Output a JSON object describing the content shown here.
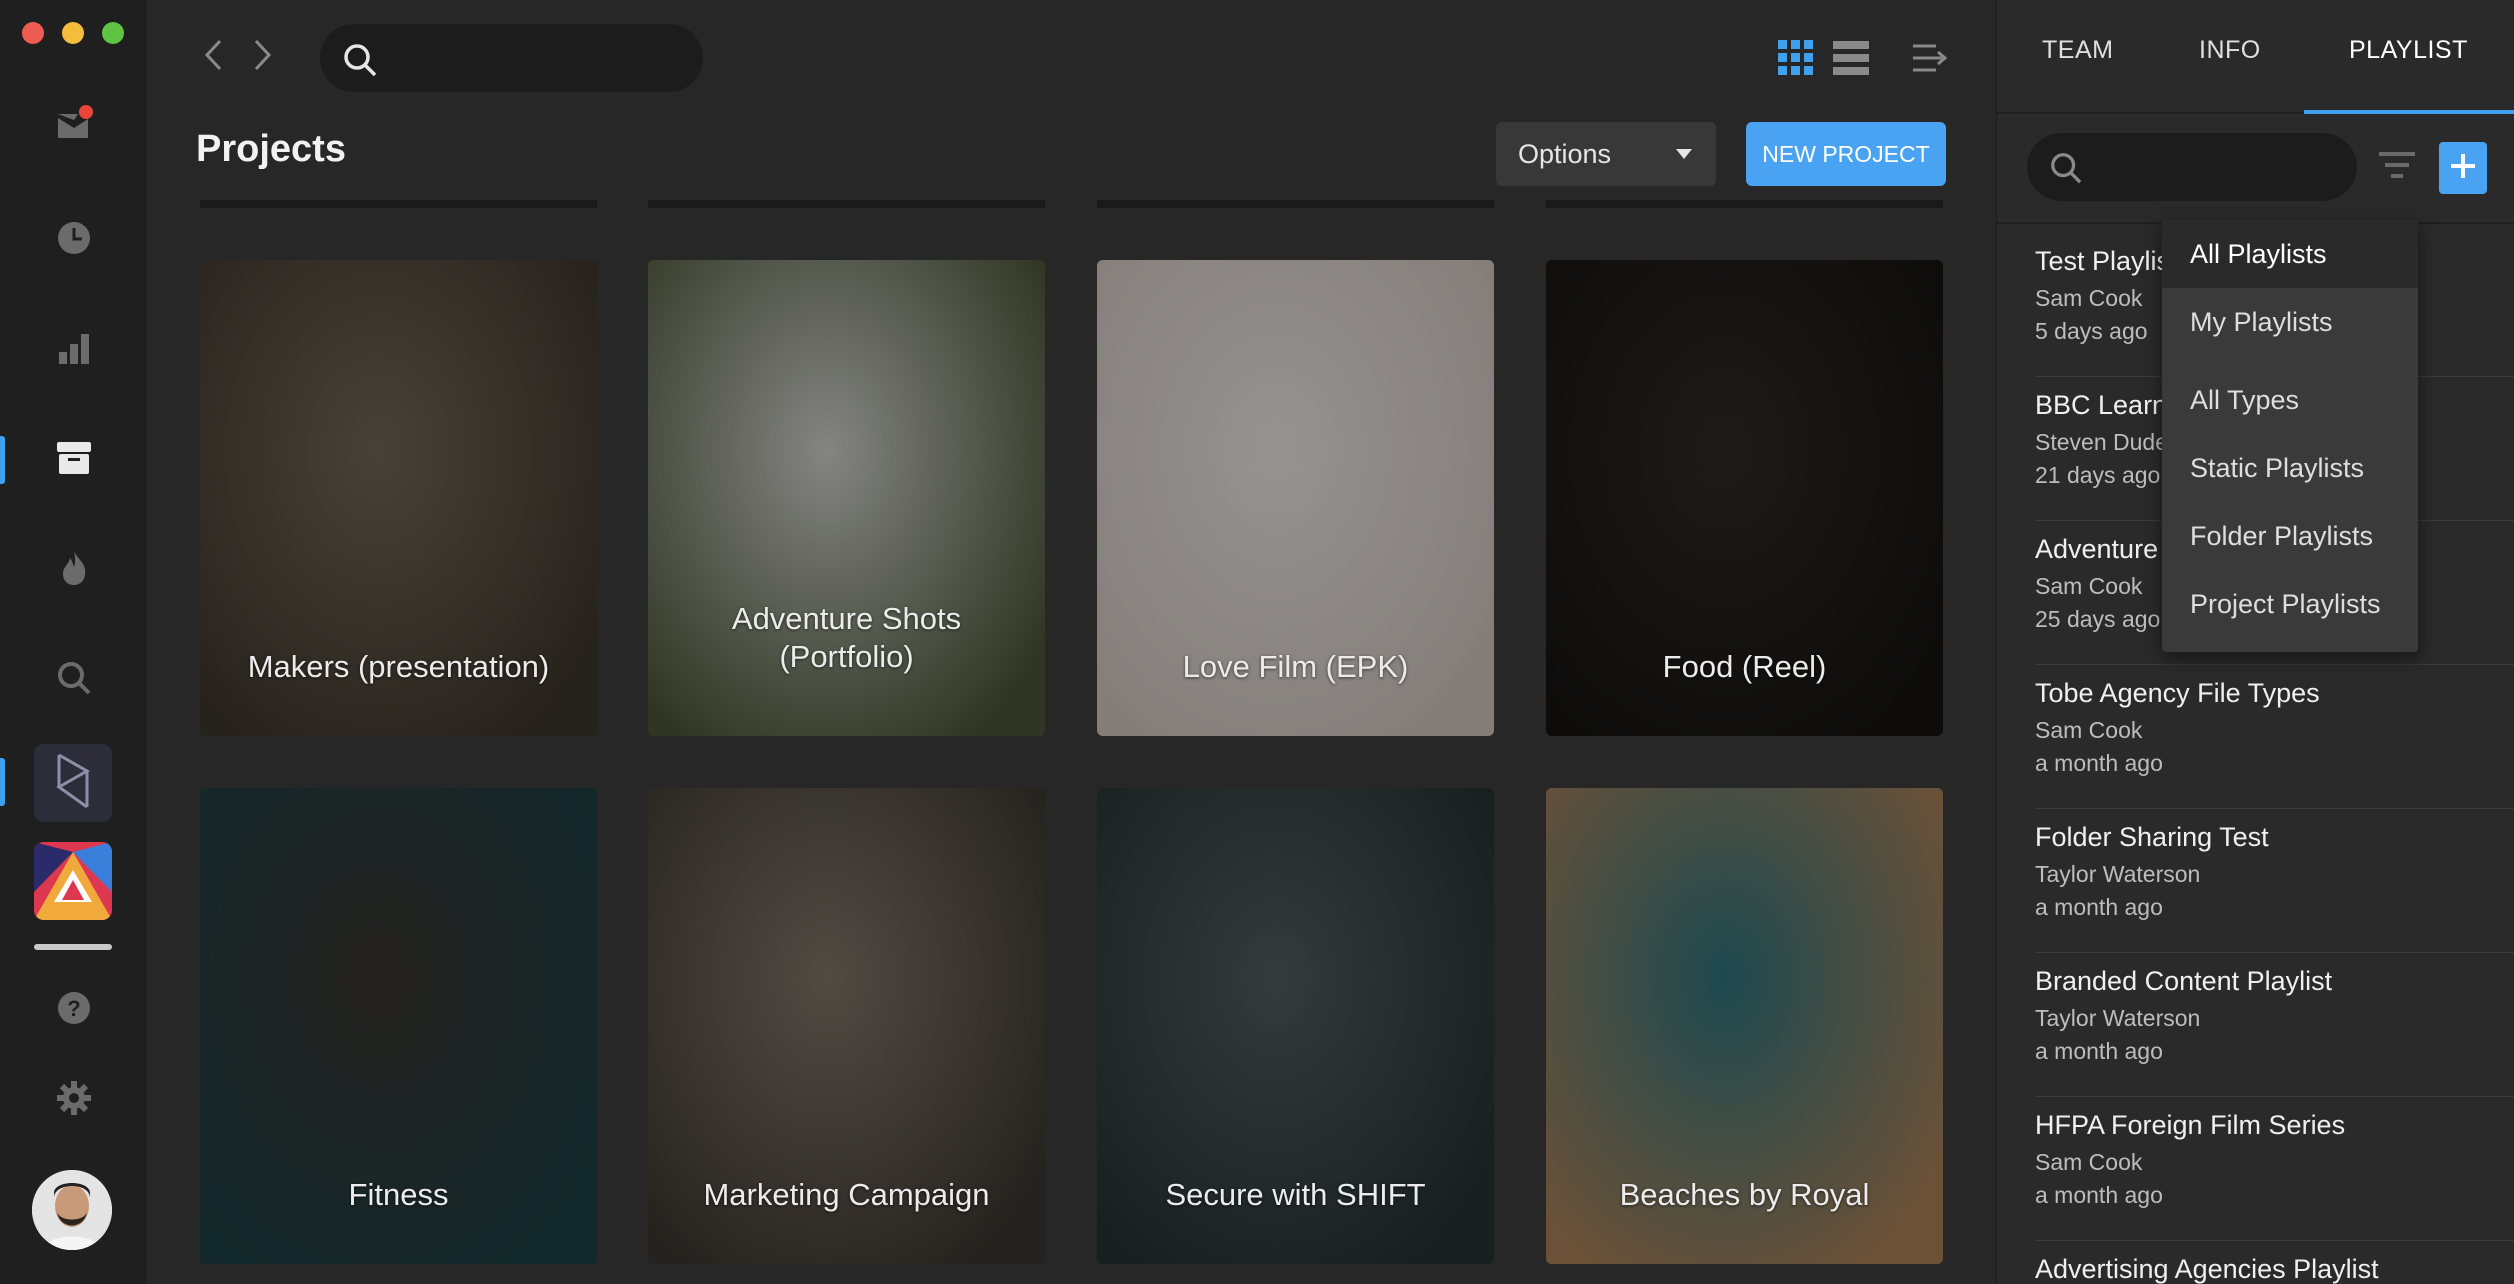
{
  "window": {
    "controls": [
      "close",
      "minimize",
      "maximize"
    ],
    "colors": {
      "close": "#ee5b52",
      "minimize": "#f4bd3b",
      "maximize": "#5fc343"
    }
  },
  "sidebar": {
    "items": [
      {
        "name": "inbox",
        "icon": "inbox-icon",
        "has_badge": true,
        "active": false
      },
      {
        "name": "recent",
        "icon": "clock-icon",
        "active": false
      },
      {
        "name": "analytics",
        "icon": "bar-chart-icon",
        "active": false
      },
      {
        "name": "projects",
        "icon": "archive-box-icon",
        "active": true
      },
      {
        "name": "trending",
        "icon": "flame-icon",
        "active": false
      },
      {
        "name": "search",
        "icon": "search-icon",
        "active": false
      },
      {
        "name": "help",
        "icon": "help-icon",
        "active": false
      },
      {
        "name": "settings",
        "icon": "gear-icon",
        "active": false
      }
    ],
    "apps": [
      {
        "name": "workspace-app",
        "icon": "shift-logo-icon",
        "active": true
      },
      {
        "name": "creative-app",
        "icon": "geometric-logo-icon"
      }
    ],
    "badge_color": "#e8453c",
    "accent": "#3fa0ee"
  },
  "header": {
    "search_placeholder": "",
    "view_icons": [
      "grid-view-icon",
      "list-view-icon",
      "queue-icon"
    ]
  },
  "main": {
    "title": "Projects",
    "options_label": "Options",
    "new_project_label": "NEW PROJECT",
    "projects": [
      {
        "label": "Makers (presentation)",
        "palette": [
          "#6e6455",
          "#3b342b"
        ]
      },
      {
        "label": "Adventure Shots\n(Portfolio)",
        "palette": [
          "#c9c9c6",
          "#4a5236"
        ]
      },
      {
        "label": "Love Film (EPK)",
        "palette": [
          "#e3dfdc",
          "#c8bfb9"
        ]
      },
      {
        "label": "Food (Reel)",
        "palette": [
          "#2c2a28",
          "#141312"
        ]
      },
      {
        "label": "Fitness",
        "palette": [
          "#3a3531",
          "#1d3d42"
        ]
      },
      {
        "label": "Marketing Campaign",
        "palette": [
          "#7b7266",
          "#3a352f"
        ]
      },
      {
        "label": "Secure with SHIFT",
        "palette": [
          "#4f5a5c",
          "#24302f"
        ]
      },
      {
        "label": "Beaches by Royal",
        "palette": [
          "#2e7079",
          "#a57c55"
        ]
      }
    ]
  },
  "panel": {
    "tabs": [
      {
        "label": "TEAM",
        "active": false
      },
      {
        "label": "INFO",
        "active": false
      },
      {
        "label": "PLAYLIST",
        "active": true
      }
    ],
    "search_placeholder": "",
    "playlists": [
      {
        "title": "Test Playlist",
        "owner": "Sam Cook",
        "date": "5 days ago"
      },
      {
        "title": "BBC Learning",
        "owner": "Steven Dude",
        "date": "21 days ago"
      },
      {
        "title": "Adventure",
        "owner": "Sam Cook",
        "date": "25 days ago"
      },
      {
        "title": "Tobe Agency File Types",
        "owner": "Sam Cook",
        "date": "a month ago"
      },
      {
        "title": "Folder Sharing Test",
        "owner": "Taylor Waterson",
        "date": "a month ago"
      },
      {
        "title": "Branded Content Playlist",
        "owner": "Taylor Waterson",
        "date": "a month ago"
      },
      {
        "title": "HFPA Foreign Film Series",
        "owner": "Sam Cook",
        "date": "a month ago"
      },
      {
        "title": "Advertising Agencies Playlist",
        "owner": "",
        "date": ""
      }
    ],
    "filter_menu": [
      {
        "label": "All Playlists",
        "selected": true
      },
      {
        "label": "My Playlists",
        "selected": false
      },
      {
        "label": "All Types",
        "selected": false
      },
      {
        "label": "Static Playlists",
        "selected": false
      },
      {
        "label": "Folder Playlists",
        "selected": false
      },
      {
        "label": "Project Playlists",
        "selected": false
      }
    ]
  }
}
